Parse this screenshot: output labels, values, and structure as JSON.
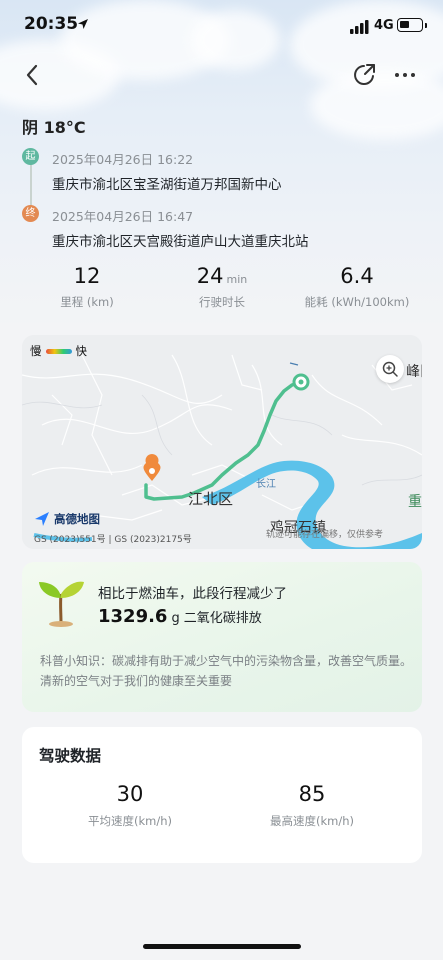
{
  "status_bar": {
    "time": "20:35",
    "network": "4G"
  },
  "weather": "阴 18°C",
  "route": {
    "start": {
      "badge": "起",
      "time": "2025年04月26日 16:22",
      "address": "重庆市渝北区宝圣湖街道万邦国新中心"
    },
    "end": {
      "badge": "终",
      "time": "2025年04月26日 16:47",
      "address": "重庆市渝北区天宫殿街道庐山大道重庆北站"
    }
  },
  "stats": [
    {
      "value": "12",
      "unit": "",
      "label": "里程 (km)"
    },
    {
      "value": "24",
      "unit": "min",
      "label": "行驶时长"
    },
    {
      "value": "6.4",
      "unit": "",
      "label": "能耗 (kWh/100km)"
    }
  ],
  "map": {
    "legend_slow": "慢",
    "legend_fast": "快",
    "labels": {
      "fengdian": "峰旧",
      "jiangbei": "江北区",
      "changjiang": "长江",
      "jiguanshi": "鸡冠石镇",
      "edge": "重"
    },
    "logo_text": "高德地图",
    "copyright": "GS (2023)551号 | GS (2023)2175号",
    "note": "轨迹可能存在偏移，仅供参考"
  },
  "eco": {
    "title": "相比于燃油车，此段行程减少了",
    "amount": "1329.6",
    "unit": "g",
    "desc": "二氧化碳排放",
    "tip": "科普小知识：碳减排有助于减少空气中的污染物含量，改善空气质量。清新的空气对于我们的健康至关重要"
  },
  "driving": {
    "title": "驾驶数据",
    "avg_speed": {
      "value": "30",
      "label": "平均速度(km/h)"
    },
    "max_speed": {
      "value": "85",
      "label": "最高速度(km/h)"
    }
  },
  "colors": {
    "route_line": "#4fbf8f",
    "start_badge": "#5fb8a0",
    "end_badge": "#e38a52",
    "river": "#5cc2ea"
  },
  "icons": [
    "location-arrow-icon",
    "signal-icon",
    "battery-icon",
    "back-arrow-icon",
    "share-icon",
    "more-icon",
    "zoom-icon",
    "plant-icon",
    "amap-logo-icon",
    "start-pin-icon",
    "end-pin-icon"
  ]
}
